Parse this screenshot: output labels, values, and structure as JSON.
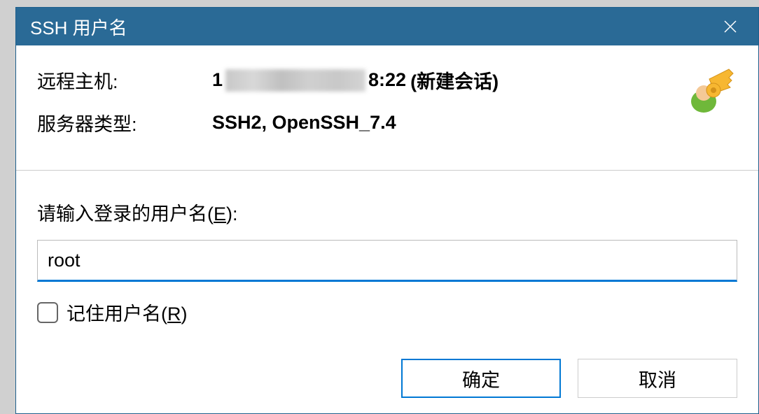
{
  "titlebar": {
    "title": "SSH 用户名"
  },
  "info": {
    "remote_host_label": "远程主机:",
    "remote_host_prefix": "1",
    "remote_host_suffix": "8:22",
    "session_label": "(新建会话)",
    "server_type_label": "服务器类型:",
    "server_type_value": "SSH2, OpenSSH_7.4"
  },
  "input": {
    "label_prefix": "请输入登录的用户名(",
    "label_accel": "E",
    "label_suffix": "):",
    "value": "root"
  },
  "checkbox": {
    "label_prefix": "记住用户名(",
    "label_accel": "R",
    "label_suffix": ")"
  },
  "buttons": {
    "ok": "确定",
    "cancel": "取消"
  }
}
